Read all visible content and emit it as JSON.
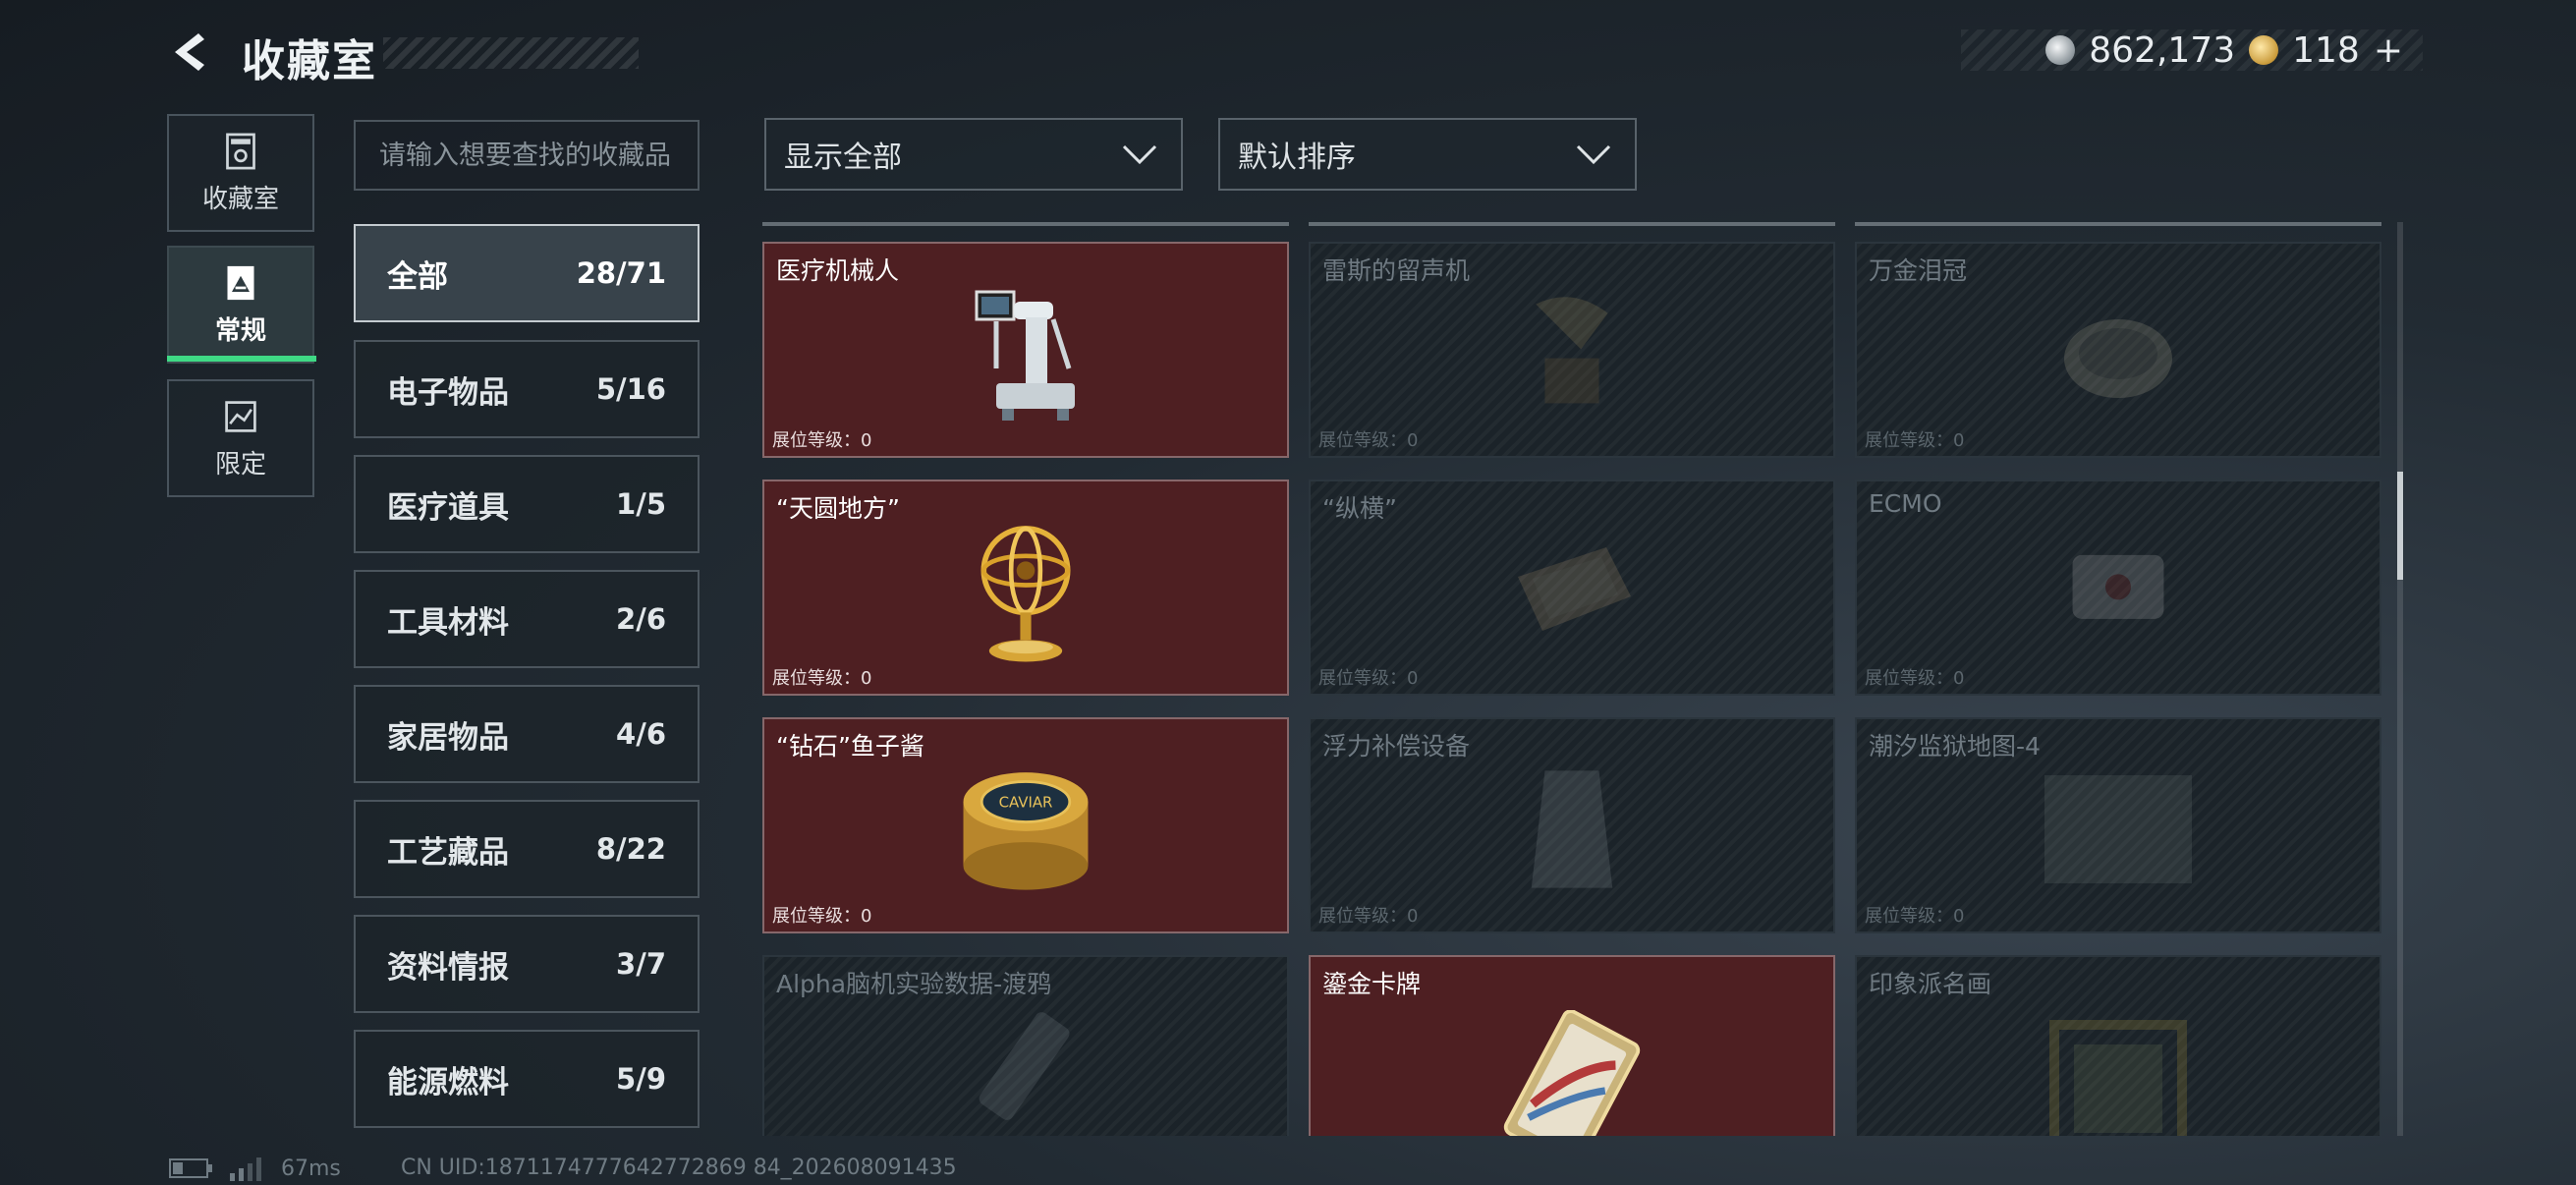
{
  "header": {
    "title": "收藏室",
    "currency": [
      {
        "icon": "silver-coin-icon",
        "value": "862,173"
      },
      {
        "icon": "gold-coin-icon",
        "value": "118"
      }
    ],
    "add_label": "+"
  },
  "nav": [
    {
      "label": "收藏室",
      "icon": "collection-room-icon",
      "active": false
    },
    {
      "label": "常规",
      "icon": "regular-card-icon",
      "active": true
    },
    {
      "label": "限定",
      "icon": "limited-map-icon",
      "active": false
    }
  ],
  "search": {
    "placeholder": "请输入想要查找的收藏品",
    "value": ""
  },
  "filter": {
    "label": "显示全部"
  },
  "sort": {
    "label": "默认排序"
  },
  "categories": [
    {
      "name": "全部",
      "count": "28/71",
      "selected": true
    },
    {
      "name": "电子物品",
      "count": "5/16"
    },
    {
      "name": "医疗道具",
      "count": "1/5"
    },
    {
      "name": "工具材料",
      "count": "2/6"
    },
    {
      "name": "家居物品",
      "count": "4/6"
    },
    {
      "name": "工艺藏品",
      "count": "8/22"
    },
    {
      "name": "资料情报",
      "count": "3/7"
    },
    {
      "name": "能源燃料",
      "count": "5/9"
    }
  ],
  "items": [
    {
      "name": "医疗机械人",
      "level": "展位等级：0",
      "owned": true,
      "icon": "medical-robot-icon"
    },
    {
      "name": "雷斯的留声机",
      "level": "展位等级：0",
      "owned": false,
      "icon": "gramophone-icon"
    },
    {
      "name": "万金泪冠",
      "level": "展位等级：0",
      "owned": false,
      "icon": "crown-icon"
    },
    {
      "name": "“天圆地方”",
      "level": "展位等级：0",
      "owned": true,
      "icon": "armillary-sphere-icon"
    },
    {
      "name": "“纵横”",
      "level": "展位等级：0",
      "owned": false,
      "icon": "board-game-icon"
    },
    {
      "name": "ECMO",
      "level": "展位等级：0",
      "owned": false,
      "icon": "ecmo-machine-icon"
    },
    {
      "name": "“钻石”鱼子酱",
      "level": "展位等级：0",
      "owned": true,
      "icon": "caviar-tin-icon",
      "tin_text": "CAVIAR"
    },
    {
      "name": "浮力补偿设备",
      "level": "展位等级：0",
      "owned": false,
      "icon": "buoyancy-vest-icon"
    },
    {
      "name": "潮汐监狱地图-4",
      "level": "展位等级：0",
      "owned": false,
      "icon": "map-icon"
    },
    {
      "name": "Alpha脑机实验数据-渡鸦",
      "level": "",
      "owned": false,
      "icon": "data-drive-icon"
    },
    {
      "name": "鎏金卡牌",
      "level": "",
      "owned": true,
      "icon": "gilded-card-icon"
    },
    {
      "name": "印象派名画",
      "level": "",
      "owned": false,
      "icon": "painting-frame-icon"
    }
  ],
  "footer": {
    "ping": "67ms",
    "uid": "CN UID:1871174777642772869 84_202608091435"
  }
}
